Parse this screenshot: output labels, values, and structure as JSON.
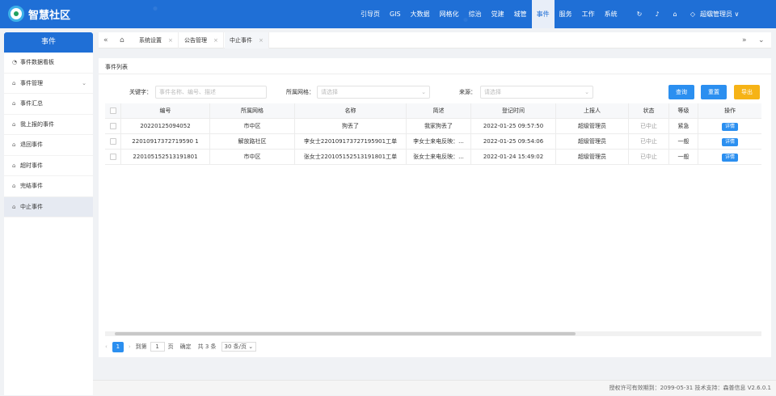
{
  "header": {
    "brand": "智慧社区",
    "nav": [
      "引导页",
      "GIS",
      "大数据",
      "网格化",
      "综治",
      "党建",
      "城管",
      "事件",
      "服务",
      "工作",
      "系统"
    ],
    "active_nav": "事件",
    "user": "超级管理员 ∨"
  },
  "sidebar": {
    "title": "事件",
    "items": [
      {
        "label": "事件数据看板",
        "icon": "dashboard-icon"
      },
      {
        "label": "事件管理",
        "icon": "home-icon",
        "has_children": true
      },
      {
        "label": "事件汇总",
        "icon": "home-icon"
      },
      {
        "label": "我上报的事件",
        "icon": "home-icon"
      },
      {
        "label": "退回事件",
        "icon": "home-icon"
      },
      {
        "label": "超时事件",
        "icon": "home-icon"
      },
      {
        "label": "完结事件",
        "icon": "home-icon"
      },
      {
        "label": "中止事件",
        "icon": "home-icon",
        "active": true
      }
    ]
  },
  "tabs": [
    {
      "label": "系统设置"
    },
    {
      "label": "公告管理"
    },
    {
      "label": "中止事件",
      "active": true
    }
  ],
  "panel": {
    "title": "事件列表"
  },
  "filters": {
    "keyword_label": "关键字：",
    "keyword_placeholder": "事件名称、编号、描述",
    "grid_label": "所属网格：",
    "grid_placeholder": "请选择",
    "source_label": "来源：",
    "source_placeholder": "请选择",
    "search_btn": "查询",
    "reset_btn": "重置",
    "export_btn": "导出"
  },
  "table": {
    "columns": [
      "编号",
      "所属网格",
      "名称",
      "简述",
      "登记时间",
      "上报人",
      "状态",
      "等级",
      "操作"
    ],
    "rows": [
      [
        "20220125094052",
        "市中区",
        "狗丢了",
        "我家狗丢了",
        "2022-01-25 09:57:50",
        "超级管理员",
        "已中止",
        "紧急",
        "详情"
      ],
      [
        "22010917372719590 1",
        "解放路社区",
        "李女士220109173727195901工单",
        "李女士来电反映：...",
        "2022-01-25 09:54:06",
        "超级管理员",
        "已中止",
        "一般",
        "详情"
      ],
      [
        "220105152513191801",
        "市中区",
        "张女士220105152513191801工单",
        "张女士来电反映：...",
        "2022-01-24 15:49:02",
        "超级管理员",
        "已中止",
        "一般",
        "详情"
      ]
    ]
  },
  "pager": {
    "current": "1",
    "goto_label": "到第",
    "goto_value": "1",
    "page_label": "页",
    "confirm": "确定",
    "total": "共 3 条",
    "page_size": "30 条/页"
  },
  "footer": {
    "text": "授权许可有效期到：2099-05-31 技术支持：森普信息  V2.6.0.1"
  },
  "colors": {
    "primary": "#1f6fd6",
    "button_blue": "#2b8ff0",
    "button_orange": "#f6b316"
  }
}
